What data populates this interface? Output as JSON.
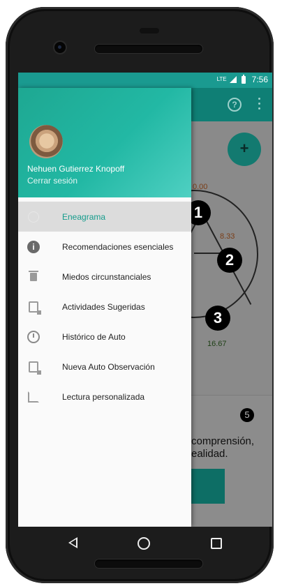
{
  "status_bar": {
    "network": "LTE",
    "time": "7:56"
  },
  "app": {
    "fab_label": "+",
    "help_icon": "question-circle-icon",
    "more_icon": "more-vert-icon",
    "scores": {
      "top": "0.00",
      "right": "8.33",
      "bottom": "16.67"
    },
    "enneagram_numbers": [
      "1",
      "2",
      "3"
    ],
    "badge": "5",
    "text_line1": "comprensión,",
    "text_line2": "ealidad."
  },
  "drawer": {
    "user_name": "Nehuen Gutierrez Knopoff",
    "logout_label": "Cerrar sesión",
    "items": [
      {
        "label": "Eneagrama",
        "icon": "enneagram-icon",
        "active": true
      },
      {
        "label": "Recomendaciones esenciales",
        "icon": "info-icon"
      },
      {
        "label": "Miedos circunstanciales",
        "icon": "trash-icon"
      },
      {
        "label": "Actividades Sugeridas",
        "icon": "clipboard-icon"
      },
      {
        "label": "Histórico de Auto",
        "icon": "clock-icon"
      },
      {
        "label": "Nueva Auto Observación",
        "icon": "clipboard-icon"
      },
      {
        "label": "Lectura personalizada",
        "icon": "crop-icon"
      }
    ]
  },
  "colors": {
    "accent": "#1a9a90",
    "header_start": "#1ea892",
    "active_label": "#159c8c"
  }
}
